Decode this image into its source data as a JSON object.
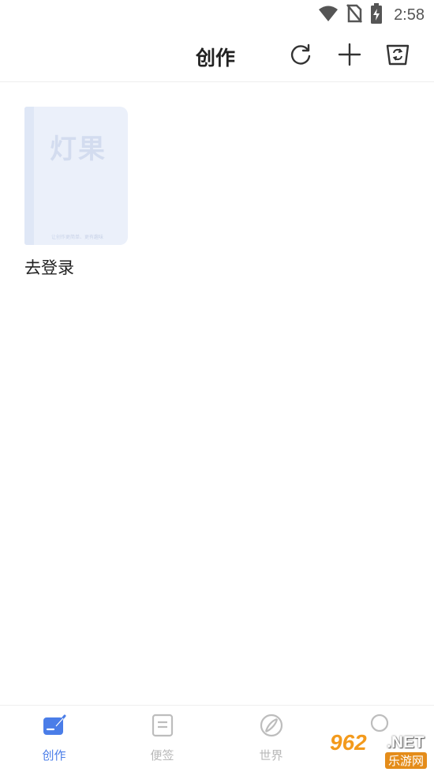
{
  "status_bar": {
    "time": "2:58",
    "icons": [
      "wifi-icon",
      "no-sim-icon",
      "battery-charging-icon"
    ]
  },
  "header": {
    "title": "创作",
    "actions": [
      "refresh-icon",
      "plus-icon",
      "recycle-bin-icon"
    ]
  },
  "books": [
    {
      "cover_logo": "灯果",
      "cover_tagline": "让创作更简单、更有趣味",
      "title": "去登录"
    }
  ],
  "tabbar": {
    "active": 0,
    "tabs": [
      {
        "label": "创作",
        "icon": "pen-square-icon"
      },
      {
        "label": "便签",
        "icon": "note-icon"
      },
      {
        "label": "世界",
        "icon": "compass-icon"
      },
      {
        "label": "",
        "icon": "profile-icon"
      }
    ]
  },
  "watermark": {
    "number": "962",
    "net": ".NET",
    "sub": "乐游网"
  },
  "colors": {
    "accent": "#4a7de8",
    "inactive": "#b8b8b8",
    "cover": "#ebf0fa"
  }
}
